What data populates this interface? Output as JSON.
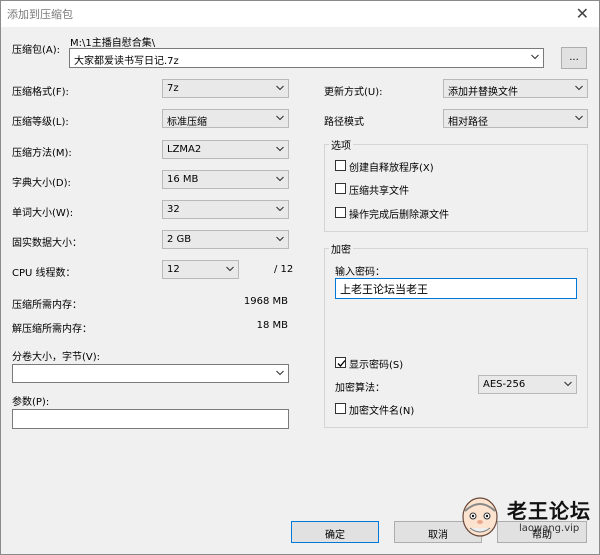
{
  "window": {
    "title": "添加到压缩包",
    "close_glyph": "✕"
  },
  "archive": {
    "label": "压缩包(A):",
    "path": "M:\\1主播自慰合集\\",
    "name": "大家都爱读书写日记.7z",
    "browse_label": "..."
  },
  "left": {
    "format": {
      "label": "压缩格式(F):",
      "value": "7z"
    },
    "level": {
      "label": "压缩等级(L):",
      "value": "标准压缩"
    },
    "method": {
      "label": "压缩方法(M):",
      "value": "LZMA2"
    },
    "dict": {
      "label": "字典大小(D):",
      "value": "16 MB"
    },
    "word": {
      "label": "单词大小(W):",
      "value": "32"
    },
    "solid": {
      "label": "固实数据大小：",
      "value": "2 GB"
    },
    "threads": {
      "label": "CPU 线程数：",
      "value": "12",
      "total": "/ 12"
    },
    "mem_comp": {
      "label": "压缩所需内存：",
      "value": "1968 MB"
    },
    "mem_decomp": {
      "label": "解压缩所需内存：",
      "value": "18 MB"
    },
    "volume": {
      "label": "分卷大小，字节(V):",
      "value": ""
    },
    "params": {
      "label": "参数(P):",
      "value": ""
    }
  },
  "right": {
    "update": {
      "label": "更新方式(U):",
      "value": "添加并替换文件"
    },
    "path_mode": {
      "label": "路径模式",
      "value": "相对路径"
    },
    "options": {
      "title": "选项",
      "sfx": {
        "label": "创建自释放程序(X)",
        "checked": false
      },
      "shared": {
        "label": "压缩共享文件",
        "checked": false
      },
      "delete": {
        "label": "操作完成后删除源文件",
        "checked": false
      }
    },
    "encryption": {
      "title": "加密",
      "password_label": "输入密码：",
      "password_value": "上老王论坛当老王",
      "show_password": {
        "label": "显示密码(S)",
        "checked": true
      },
      "method_label": "加密算法：",
      "method_value": "AES-256",
      "encrypt_names": {
        "label": "加密文件名(N)",
        "checked": false
      }
    }
  },
  "buttons": {
    "ok": "确定",
    "cancel": "取消",
    "help": "帮助"
  },
  "watermark": {
    "name": "老王论坛",
    "url": "laowang.vip"
  }
}
